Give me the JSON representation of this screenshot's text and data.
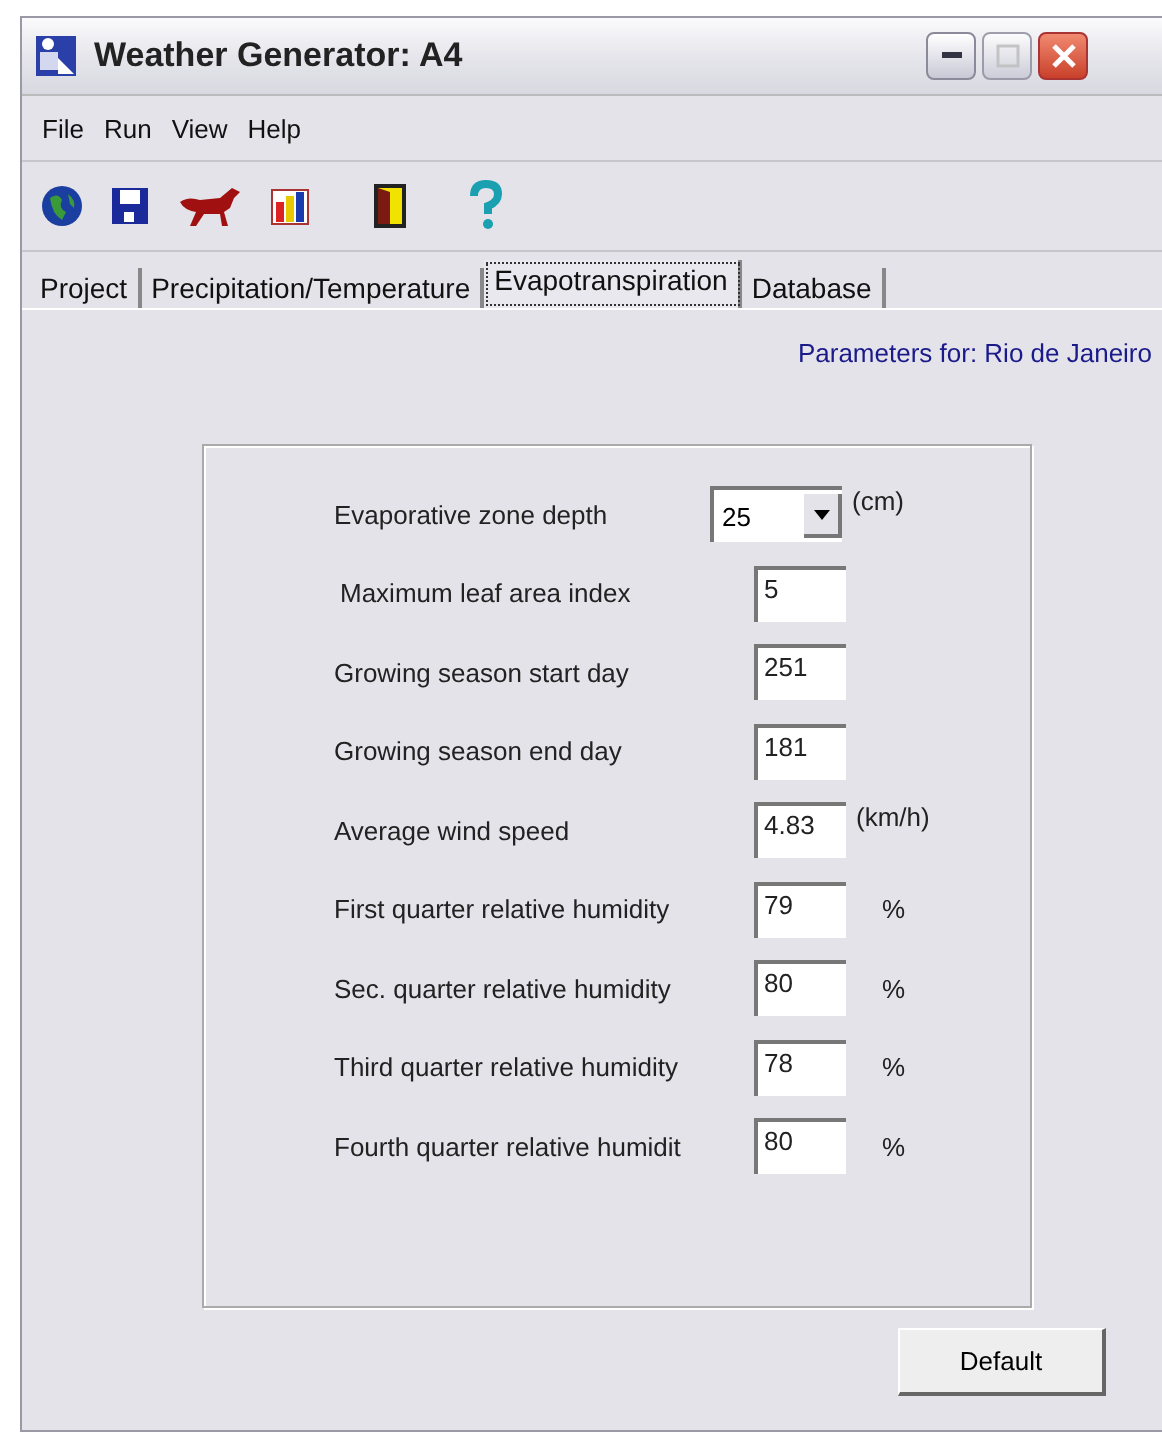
{
  "window": {
    "title": "Weather Generator: A4"
  },
  "menu": [
    "File",
    "Run",
    "View",
    "Help"
  ],
  "tabs": [
    {
      "label": "Project",
      "selected": false
    },
    {
      "label": "Precipitation/Temperature",
      "selected": false
    },
    {
      "label": "Evapotranspiration",
      "selected": true
    },
    {
      "label": "Database",
      "selected": false
    }
  ],
  "parameters_for": "Parameters for: Rio de Janeiro",
  "fields": [
    {
      "kind": "dropdown",
      "label": "Evaporative zone depth",
      "value": "25",
      "unit": "(cm)"
    },
    {
      "kind": "text",
      "label": "Maximum leaf area index",
      "value": "5"
    },
    {
      "kind": "text",
      "label": "Growing season start day",
      "value": "251"
    },
    {
      "kind": "text",
      "label": "Growing season end day",
      "value": "181"
    },
    {
      "kind": "text",
      "label": "Average wind speed",
      "value": "4.83",
      "unit": "(km/h)"
    },
    {
      "kind": "text",
      "label": "First quarter relative humidity",
      "value": "79",
      "unit": "%"
    },
    {
      "kind": "text",
      "label": "Sec. quarter relative humidity",
      "value": "80",
      "unit": "%"
    },
    {
      "kind": "text",
      "label": "Third quarter relative humidity",
      "value": "78",
      "unit": "%"
    },
    {
      "kind": "text",
      "label": "Fourth quarter relative humidit",
      "value": "80",
      "unit": "%"
    }
  ],
  "buttons": [
    "Default"
  ]
}
